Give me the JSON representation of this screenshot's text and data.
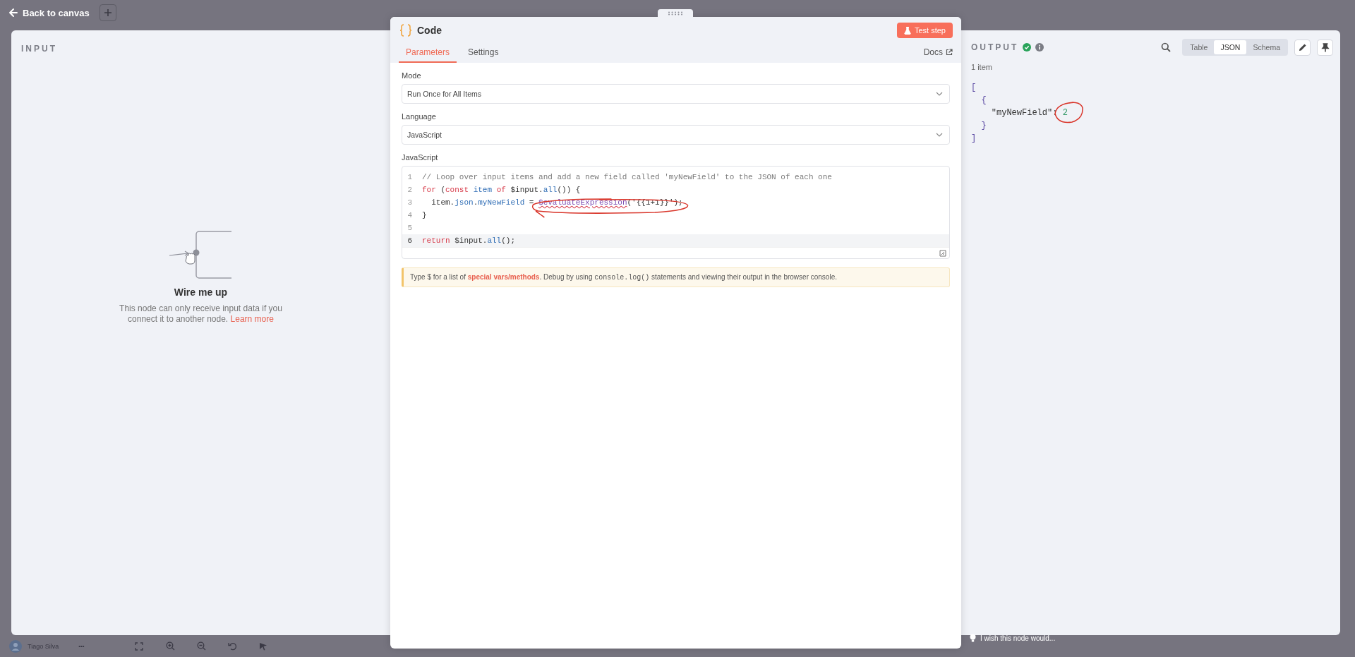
{
  "top_bar": {
    "back_link": "Back to canvas"
  },
  "canvas_footer": {
    "user": "Tiago Silva",
    "more": "•••"
  },
  "input_panel": {
    "title": "INPUT",
    "empty_state": {
      "heading": "Wire me up",
      "text": "This node can only receive input data if you connect it to another node.",
      "link": "Learn more"
    }
  },
  "node_panel": {
    "title": "Code",
    "test_button": "Test step",
    "tabs": [
      {
        "label": "Parameters",
        "selected": true
      },
      {
        "label": "Settings",
        "selected": false
      }
    ],
    "docs_link": "Docs",
    "fields": [
      {
        "kind": "select",
        "label": "Mode",
        "value": "Run Once for All Items"
      },
      {
        "kind": "select",
        "label": "Language",
        "value": "JavaScript"
      },
      {
        "kind": "code",
        "label": "JavaScript",
        "lines": [
          {
            "number": "1",
            "active": false,
            "tokens": [
              {
                "kind": "comment",
                "text": "// Loop over input items and add a new field called 'myNewField' to the JSON of each one"
              }
            ]
          },
          {
            "number": "2",
            "active": false,
            "tokens": [
              {
                "kind": "keyword",
                "text": "for"
              },
              {
                "kind": "plain",
                "text": " ("
              },
              {
                "kind": "keyword",
                "text": "const "
              },
              {
                "kind": "property",
                "text": "item "
              },
              {
                "kind": "keyword",
                "text": "of"
              },
              {
                "kind": "plain",
                "text": " $input."
              },
              {
                "kind": "property",
                "text": "all"
              },
              {
                "kind": "plain",
                "text": "()) {"
              }
            ]
          },
          {
            "number": "3",
            "active": false,
            "tokens": [
              {
                "kind": "plain",
                "text": "  item."
              },
              {
                "kind": "property",
                "text": "json"
              },
              {
                "kind": "plain",
                "text": "."
              },
              {
                "kind": "property",
                "text": "myNewField"
              },
              {
                "kind": "plain",
                "text": " = "
              },
              {
                "kind": "function",
                "text": "$evaluateExpression"
              },
              {
                "kind": "plain",
                "text": "('{{1+1}}');"
              }
            ]
          },
          {
            "number": "4",
            "active": false,
            "tokens": [
              {
                "kind": "plain",
                "text": "}"
              }
            ]
          },
          {
            "number": "5",
            "active": false
          },
          {
            "number": "6",
            "active": true,
            "tokens": [
              {
                "kind": "keyword",
                "text": "return"
              },
              {
                "kind": "plain",
                "text": " $input."
              },
              {
                "kind": "property",
                "text": "all"
              },
              {
                "kind": "plain",
                "text": "();"
              }
            ]
          }
        ]
      }
    ],
    "notice": [
      {
        "kind": "text",
        "text": "Type $ for a list of "
      },
      {
        "kind": "link",
        "text": "special vars/methods"
      },
      {
        "kind": "text",
        "text": ". Debug by using "
      },
      {
        "kind": "code",
        "text": "console.log()"
      },
      {
        "kind": "text",
        "text": " statements and viewing their output in the browser console."
      }
    ]
  },
  "output_panel": {
    "title": "OUTPUT",
    "success": true,
    "views": [
      {
        "label": "Table",
        "selected": false
      },
      {
        "label": "JSON",
        "selected": true
      },
      {
        "label": "Schema",
        "selected": false
      }
    ],
    "item_count": "1 item",
    "json_lines": [
      {
        "tokens": [
          {
            "kind": "bracket",
            "text": "["
          }
        ]
      },
      {
        "tokens": [
          {
            "kind": "bracket",
            "text": "  {"
          }
        ]
      },
      {
        "tokens": [
          {
            "kind": "key",
            "text": "    \"myNewField\""
          },
          {
            "kind": "plain",
            "text": ": "
          },
          {
            "kind": "number",
            "text": "2"
          }
        ]
      },
      {
        "tokens": [
          {
            "kind": "bracket",
            "text": "  }"
          }
        ]
      },
      {
        "tokens": [
          {
            "kind": "bracket",
            "text": "]"
          }
        ]
      }
    ],
    "feedback": "I wish this node would..."
  }
}
